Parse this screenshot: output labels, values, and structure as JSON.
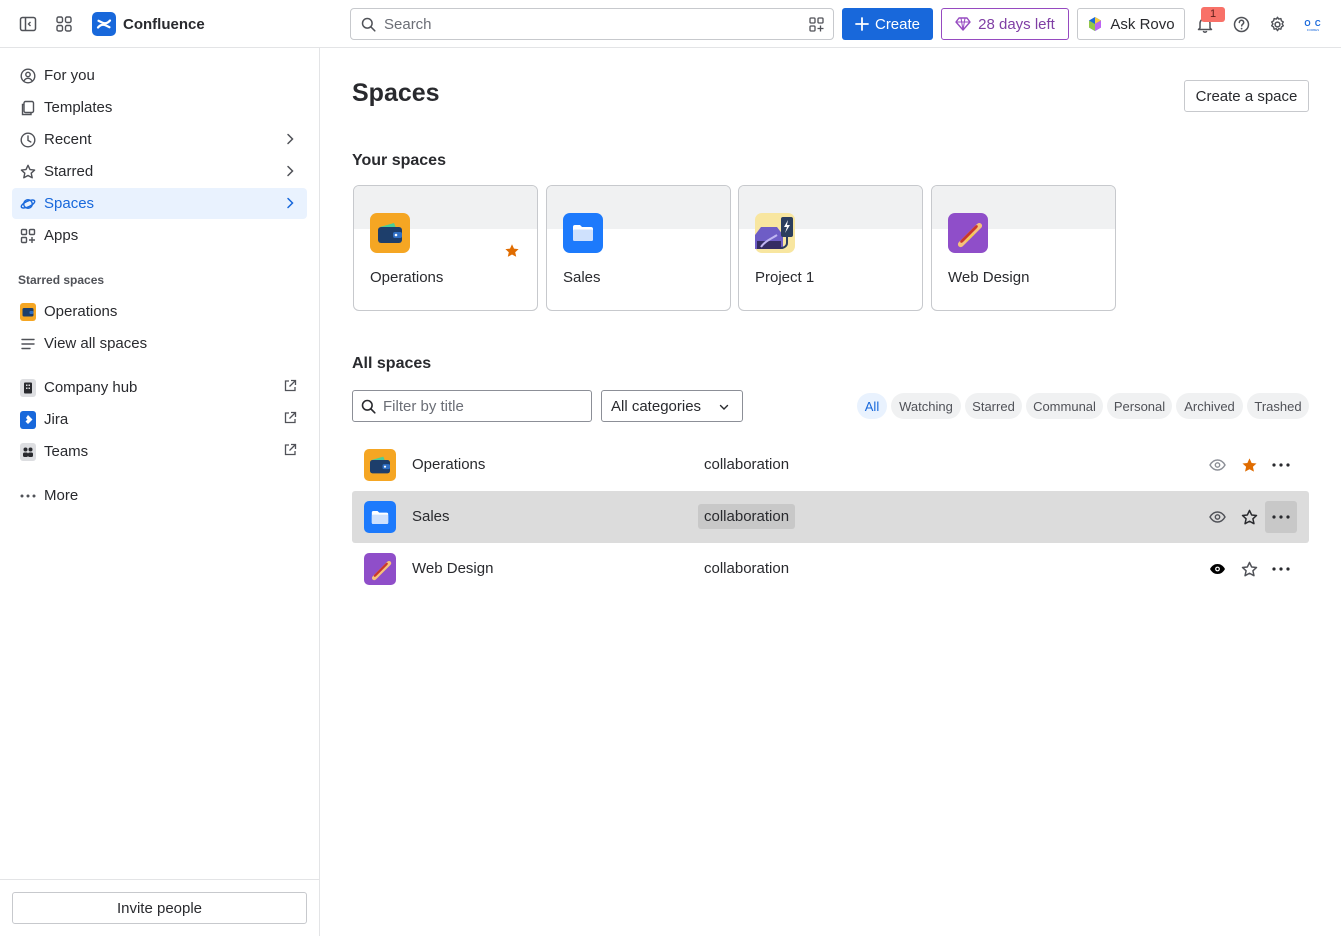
{
  "app": {
    "name": "Confluence"
  },
  "topbar": {
    "search_placeholder": "Search",
    "create_label": "Create",
    "trial_label": "28 days left",
    "rovo_label": "Ask Rovo",
    "notification_count": "1",
    "avatar_text_top": "O C",
    "avatar_text_bottom": "FORBES",
    "colors": {
      "primary": "#1868db",
      "trial": "#964ac0"
    }
  },
  "sidebar": {
    "items": [
      {
        "label": "For you",
        "icon": "person-circle-icon"
      },
      {
        "label": "Templates",
        "icon": "templates-icon"
      },
      {
        "label": "Recent",
        "icon": "clock-icon",
        "chevron": true
      },
      {
        "label": "Starred",
        "icon": "star-icon",
        "chevron": true
      },
      {
        "label": "Spaces",
        "icon": "planet-icon",
        "chevron": true,
        "selected": true
      },
      {
        "label": "Apps",
        "icon": "apps-add-icon"
      }
    ],
    "starred_heading": "Starred spaces",
    "starred": [
      {
        "label": "Operations",
        "icon": "wallet-icon"
      },
      {
        "label": "View all spaces",
        "icon": "list-icon"
      }
    ],
    "links": [
      {
        "label": "Company hub",
        "icon": "building-icon",
        "external": true
      },
      {
        "label": "Jira",
        "icon": "jira-icon",
        "external": true
      },
      {
        "label": "Teams",
        "icon": "teams-icon",
        "external": true
      }
    ],
    "more_label": "More",
    "invite_label": "Invite people"
  },
  "main": {
    "title": "Spaces",
    "create_space_label": "Create a space",
    "your_spaces_heading": "Your spaces",
    "your_spaces": [
      {
        "name": "Operations",
        "icon": "wallet-icon",
        "starred": true
      },
      {
        "name": "Sales",
        "icon": "folder-icon",
        "starred": false
      },
      {
        "name": "Project 1",
        "icon": "car-charging-icon",
        "starred": false
      },
      {
        "name": "Web Design",
        "icon": "hotdog-icon",
        "starred": false
      }
    ],
    "all_spaces_heading": "All spaces",
    "filter_placeholder": "Filter by title",
    "category_select": "All categories",
    "chips": [
      "All",
      "Watching",
      "Starred",
      "Communal",
      "Personal",
      "Archived",
      "Trashed"
    ],
    "active_chip": "All",
    "rows": [
      {
        "name": "Operations",
        "category": "collaboration",
        "icon": "wallet-icon",
        "watching": false,
        "starred": true
      },
      {
        "name": "Sales",
        "category": "collaboration",
        "icon": "folder-icon",
        "watching": false,
        "starred": false,
        "hovered": true
      },
      {
        "name": "Web Design",
        "category": "collaboration",
        "icon": "hotdog-icon",
        "watching": true,
        "starred": false
      }
    ]
  }
}
